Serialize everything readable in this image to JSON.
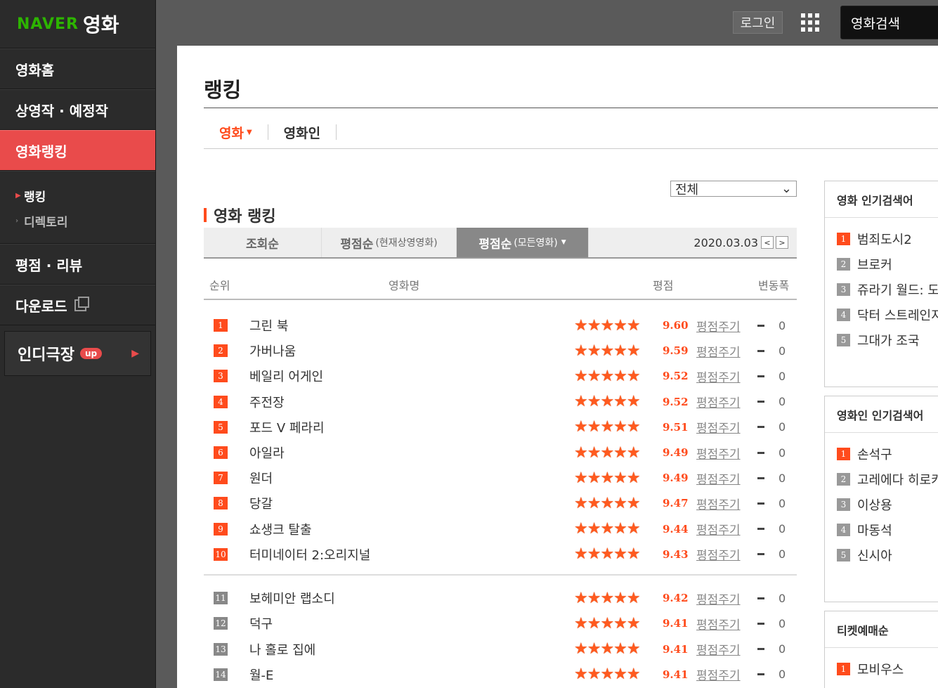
{
  "logo": {
    "naver": "NAVER",
    "movie": "영화"
  },
  "sidebar": {
    "items": [
      {
        "label": "영화홈"
      },
      {
        "label": "상영작 · 예정작"
      },
      {
        "label": "영화랭킹"
      }
    ],
    "sub": [
      {
        "label": "랭킹"
      },
      {
        "label": "디렉토리"
      }
    ],
    "items2": [
      {
        "label": "평점 · 리뷰"
      },
      {
        "label": "다운로드"
      }
    ],
    "indie": {
      "label": "인디극장",
      "badge": "up"
    }
  },
  "header": {
    "login": "로그인",
    "search_placeholder": "영화검색"
  },
  "page": {
    "title": "랭킹",
    "tabs": [
      {
        "label": "영화"
      },
      {
        "label": "영화인"
      }
    ],
    "filter": "전체",
    "section_title": "영화 랭킹",
    "sorts": {
      "views": "조회순",
      "current_main": "평점순",
      "current_sub": "(현재상영영화)",
      "all_main": "평점순",
      "all_sub": "(모든영화)"
    },
    "date": "2020.03.03",
    "columns": {
      "rank": "순위",
      "title": "영화명",
      "score": "평점",
      "change": "변동폭"
    },
    "rate_label": "평점주기",
    "movies": [
      {
        "rank": "1",
        "title": "그린 북",
        "score": "9.60",
        "change": "0"
      },
      {
        "rank": "2",
        "title": "가버나움",
        "score": "9.59",
        "change": "0"
      },
      {
        "rank": "3",
        "title": "베일리 어게인",
        "score": "9.52",
        "change": "0"
      },
      {
        "rank": "4",
        "title": "주전장",
        "score": "9.52",
        "change": "0"
      },
      {
        "rank": "5",
        "title": "포드 V 페라리",
        "score": "9.51",
        "change": "0"
      },
      {
        "rank": "6",
        "title": "아일라",
        "score": "9.49",
        "change": "0"
      },
      {
        "rank": "7",
        "title": "원더",
        "score": "9.49",
        "change": "0"
      },
      {
        "rank": "8",
        "title": "당갈",
        "score": "9.47",
        "change": "0"
      },
      {
        "rank": "9",
        "title": "쇼생크 탈출",
        "score": "9.44",
        "change": "0"
      },
      {
        "rank": "10",
        "title": "터미네이터 2:오리지널",
        "score": "9.43",
        "change": "0"
      },
      {
        "rank": "11",
        "title": "보헤미안 랩소디",
        "score": "9.42",
        "change": "0"
      },
      {
        "rank": "12",
        "title": "덕구",
        "score": "9.41",
        "change": "0"
      },
      {
        "rank": "13",
        "title": "나 홀로 집에",
        "score": "9.41",
        "change": "0"
      },
      {
        "rank": "14",
        "title": "월-E",
        "score": "9.41",
        "change": "0"
      }
    ]
  },
  "side": {
    "movie_search": {
      "title": "영화 인기검색어",
      "items": [
        "범죄도시2",
        "브로커",
        "쥬라기 월드: 도미니언",
        "닥터 스트레인지",
        "그대가 조국"
      ]
    },
    "person_search": {
      "title": "영화인 인기검색어",
      "items": [
        "손석구",
        "고레에다 히로카즈",
        "이상용",
        "마동석",
        "신시아"
      ]
    },
    "ticket": {
      "title": "티켓예매순",
      "items": [
        "모비우스"
      ]
    }
  },
  "colors": {
    "accent": "#ff4b1c",
    "sidebar_active": "#e94b4b",
    "naver_green": "#2db400"
  }
}
